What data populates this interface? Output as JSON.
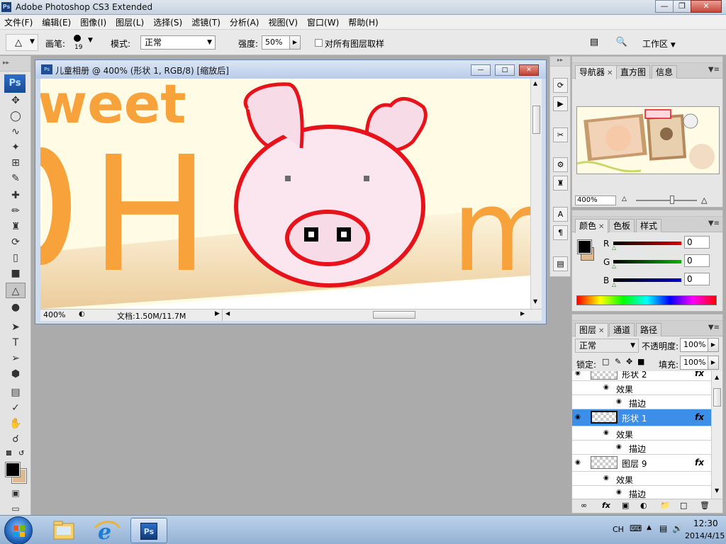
{
  "app": {
    "title": "Adobe Photoshop CS3 Extended",
    "logo": "Ps"
  },
  "menu": [
    "文件(F)",
    "编辑(E)",
    "图像(I)",
    "图层(L)",
    "选择(S)",
    "滤镜(T)",
    "分析(A)",
    "视图(V)",
    "窗口(W)",
    "帮助(H)"
  ],
  "options": {
    "brush_label": "画笔:",
    "brush_size": "19",
    "mode_label": "模式:",
    "mode_value": "正常",
    "strength_label": "强度:",
    "strength_value": "50%",
    "sample_all_label": "对所有图层取样",
    "workspace_label": "工作区"
  },
  "toolbox": {
    "badge": "Ps",
    "tools": [
      "move-icon",
      "marquee-icon",
      "lasso-icon",
      "magic-wand-icon",
      "crop-icon",
      "slice-icon",
      "healing-brush-icon",
      "brush-icon",
      "clone-stamp-icon",
      "history-brush-icon",
      "eraser-icon",
      "gradient-icon",
      "blur-icon",
      "dodge-icon",
      "path-select-icon",
      "type-icon",
      "direct-select-icon",
      "shape-icon",
      "notes-icon",
      "eyedropper-icon",
      "hand-icon",
      "zoom-icon"
    ],
    "fg_color": "#000000",
    "bg_color": "#e0b98f"
  },
  "document": {
    "title": "儿童相册 @ 400% (形状 1, RGB/8) [缩放后]",
    "zoom": "400%",
    "doc_info": "文档:1.50M/11.7M",
    "canvas_text_top": "weet",
    "canvas_letter_left": "H",
    "canvas_letter_right": "m"
  },
  "navigator": {
    "tabs": [
      "导航器",
      "直方图",
      "信息"
    ],
    "zoom": "400%"
  },
  "color": {
    "tabs": [
      "颜色",
      "色板",
      "样式"
    ],
    "channels": [
      {
        "label": "R",
        "value": "0",
        "color": "#e00000"
      },
      {
        "label": "G",
        "value": "0",
        "color": "#00b400"
      },
      {
        "label": "B",
        "value": "0",
        "color": "#0000c8"
      }
    ]
  },
  "layers": {
    "tabs": [
      "图层",
      "通道",
      "路径"
    ],
    "blend_mode": "正常",
    "opacity_label": "不透明度:",
    "opacity_value": "100%",
    "lock_label": "锁定:",
    "fill_label": "填充:",
    "fill_value": "100%",
    "effects_label": "效果",
    "stroke_label": "描边",
    "items": [
      {
        "name": "形状 2",
        "selected": false
      },
      {
        "name": "形状 1",
        "selected": true
      },
      {
        "name": "图层 9",
        "selected": false
      }
    ]
  },
  "taskbar": {
    "lang": "CH",
    "time": "12:30",
    "date": "2014/4/15",
    "ps_label": "Ps"
  }
}
